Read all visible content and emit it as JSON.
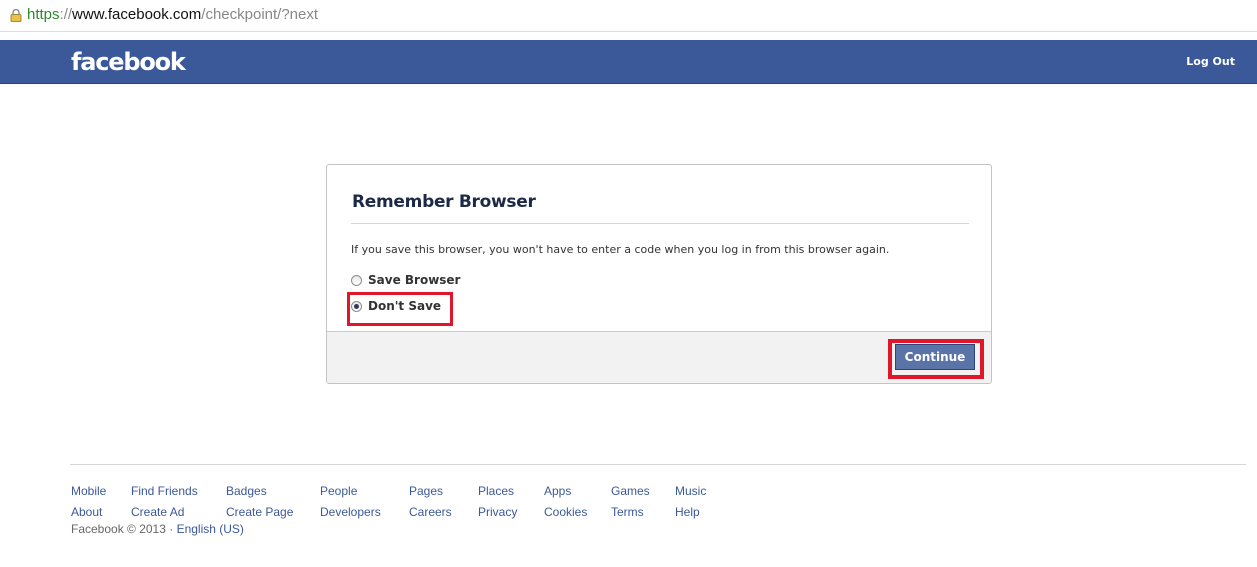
{
  "browser": {
    "url_scheme": "https",
    "url_sep": "://",
    "url_host": "www.facebook.com",
    "url_path": "/checkpoint/?next",
    "lock_icon": "lock-icon"
  },
  "header": {
    "logo": "facebook",
    "logout": "Log Out",
    "color": "#3b5998"
  },
  "dialog": {
    "title": "Remember Browser",
    "description": "If you save this browser, you won't have to enter a code when you log in from this browser again.",
    "options": [
      {
        "label": "Save Browser",
        "selected": false
      },
      {
        "label": "Don't Save",
        "selected": true
      }
    ],
    "continue_label": "Continue"
  },
  "footer": {
    "row1": [
      "Mobile",
      "Find Friends",
      "Badges",
      "People",
      "Pages",
      "Places",
      "Apps",
      "Games",
      "Music"
    ],
    "row2": [
      "About",
      "Create Ad",
      "Create Page",
      "Developers",
      "Careers",
      "Privacy",
      "Cookies",
      "Terms",
      "Help"
    ],
    "copyright": "Facebook © 2013 · ",
    "language": "English (US)"
  },
  "highlight_color": "#e0162b"
}
